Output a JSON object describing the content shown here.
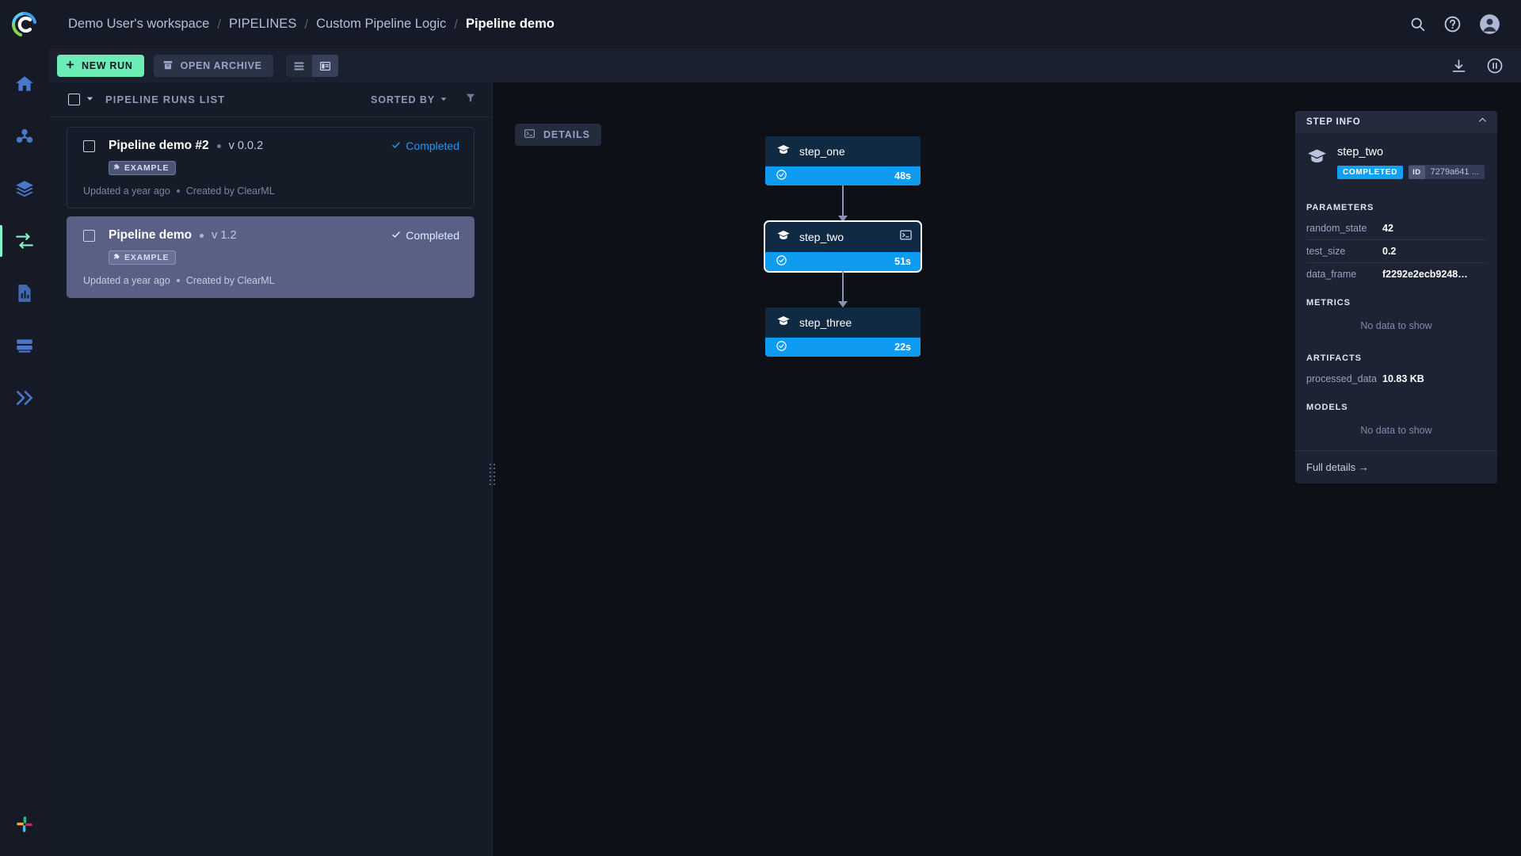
{
  "breadcrumb": {
    "items": [
      {
        "label": "Demo User's workspace",
        "current": false
      },
      {
        "label": "PIPELINES",
        "current": false
      },
      {
        "label": "Custom Pipeline Logic",
        "current": false
      },
      {
        "label": "Pipeline demo",
        "current": true
      }
    ],
    "separator": "/"
  },
  "topbar": {
    "search_icon": "search-icon",
    "help_icon": "help-circle-icon",
    "account_icon": "user-avatar-icon"
  },
  "toolbar": {
    "new_run_label": "NEW RUN",
    "new_run_icon": "plus-icon",
    "new_run_color": "#6bedb5",
    "open_archive_label": "OPEN ARCHIVE",
    "open_archive_icon": "archive-box-icon",
    "view_table_icon": "table-view-icon",
    "view_split_icon": "split-view-icon",
    "active_view": "split",
    "download_icon": "download-icon",
    "pause_icon": "pause-circle-icon"
  },
  "runs_panel": {
    "title": "PIPELINE RUNS LIST",
    "sort_label": "SORTED BY",
    "sort_caret_icon": "chevron-down-icon",
    "filter_icon": "filter-icon",
    "select_all_icon": "checkbox-icon",
    "runs": [
      {
        "name": "Pipeline demo #2",
        "version": "v 0.0.2",
        "status": "Completed",
        "status_icon": "check-icon",
        "tag": "EXAMPLE",
        "tag_icon": "puzzle-piece-icon",
        "updated": "Updated a year ago",
        "created_by": "Created by ClearML",
        "selected": false
      },
      {
        "name": "Pipeline demo",
        "version": "v 1.2",
        "status": "Completed",
        "status_icon": "check-icon",
        "tag": "EXAMPLE",
        "tag_icon": "puzzle-piece-icon",
        "updated": "Updated a year ago",
        "created_by": "Created by ClearML",
        "selected": true
      }
    ]
  },
  "canvas": {
    "details_label": "DETAILS",
    "details_icon": "terminal-icon",
    "node_status_icon": "check-circle-icon",
    "node_type_icon": "graduation-cap-icon",
    "node_footer_color": "#0f9bf0",
    "nodes": [
      {
        "name": "step_one",
        "duration": "48s",
        "selected": false,
        "has_terminal_icon": false
      },
      {
        "name": "step_two",
        "duration": "51s",
        "selected": true,
        "has_terminal_icon": true
      },
      {
        "name": "step_three",
        "duration": "22s",
        "selected": false,
        "has_terminal_icon": false
      }
    ]
  },
  "step_info": {
    "panel_title": "STEP INFO",
    "collapse_icon": "chevron-up-icon",
    "task_icon": "graduation-cap-icon",
    "task_name": "step_two",
    "status_badge": "COMPLETED",
    "status_color": "#11a0f4",
    "id_label": "ID",
    "id_value": "7279a641 ...",
    "parameters_title": "PARAMETERS",
    "parameters": [
      {
        "key": "random_state",
        "value": "42"
      },
      {
        "key": "test_size",
        "value": "0.2"
      },
      {
        "key": "data_frame",
        "value": "f2292e2ecb9248…"
      }
    ],
    "metrics_title": "METRICS",
    "metrics_empty": "No data to show",
    "artifacts_title": "ARTIFACTS",
    "artifacts": [
      {
        "key": "processed_data",
        "value": "10.83 KB"
      }
    ],
    "models_title": "MODELS",
    "models_empty": "No data to show",
    "full_details_label": "Full details →"
  },
  "sidebar": {
    "items": [
      {
        "icon": "home-icon",
        "active": false
      },
      {
        "icon": "projects-icon",
        "active": false
      },
      {
        "icon": "datasets-icon",
        "active": false
      },
      {
        "icon": "pipelines-icon",
        "active": true
      },
      {
        "icon": "reports-icon",
        "active": false
      },
      {
        "icon": "workers-icon",
        "active": false
      },
      {
        "icon": "applications-icon",
        "active": false
      }
    ],
    "bottom_icon": "slack-icon"
  }
}
